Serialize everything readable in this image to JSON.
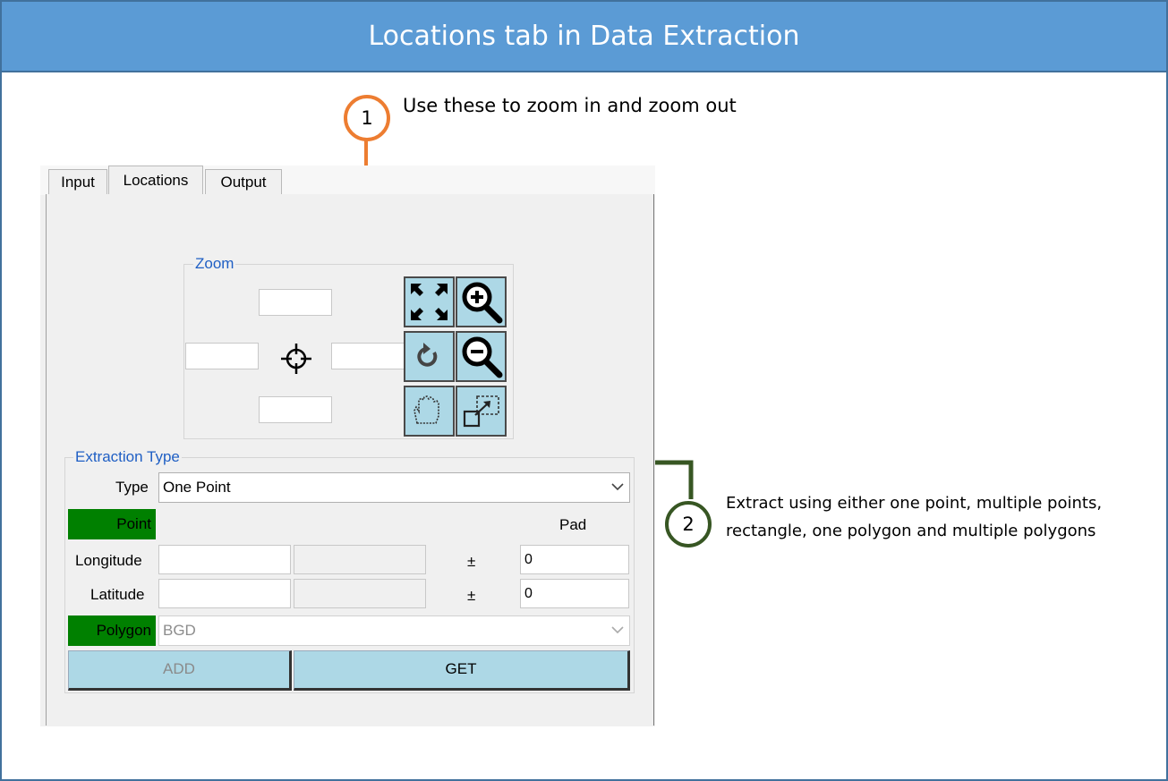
{
  "banner": {
    "title": "Locations tab in Data Extraction"
  },
  "callouts": [
    {
      "number": "1",
      "text": "Use these to zoom in and zoom out"
    },
    {
      "number": "2",
      "line1": "Extract using either one point, multiple points,",
      "line2": "rectangle, one polygon and multiple polygons"
    }
  ],
  "tabs": [
    {
      "label": "Input"
    },
    {
      "label": "Locations"
    },
    {
      "label": "Output"
    }
  ],
  "zoom": {
    "label": "Zoom",
    "buttons": [
      {
        "icon": "expand-icon"
      },
      {
        "icon": "zoom-in-icon"
      },
      {
        "icon": "refresh-icon"
      },
      {
        "icon": "zoom-out-icon"
      },
      {
        "icon": "pan-hand-icon"
      },
      {
        "icon": "zoom-box-icon"
      }
    ],
    "center_icon": "crosshair-icon"
  },
  "extraction": {
    "label": "Extraction Type",
    "type_label": "Type",
    "type_value": "One Point",
    "point_label": "Point",
    "pad_label": "Pad",
    "longitude_label": "Longitude",
    "latitude_label": "Latitude",
    "plus_minus": "±",
    "longitude_pad": "0",
    "latitude_pad": "0",
    "polygon_label": "Polygon",
    "polygon_value": "BGD",
    "add_label": "ADD",
    "get_label": "GET"
  },
  "colors": {
    "banner": "#5b9bd5",
    "callout1": "#ed7d31",
    "callout2": "#375623",
    "button": "#add8e6",
    "active_label": "#008000"
  }
}
